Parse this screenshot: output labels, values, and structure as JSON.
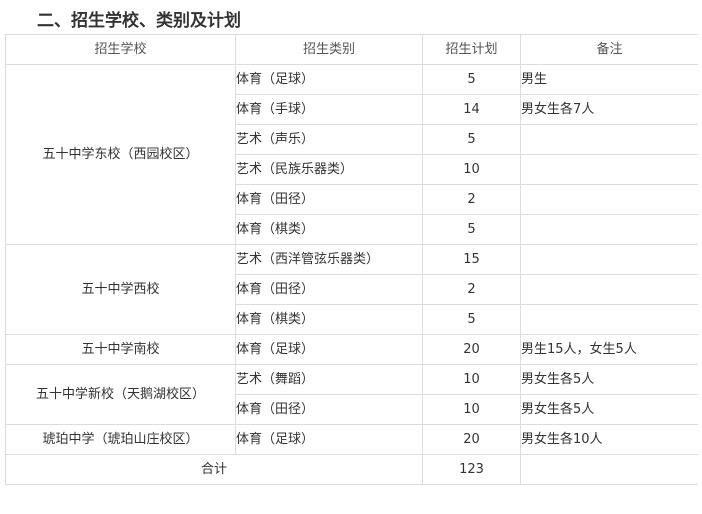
{
  "heading": "二、招生学校、类别及计划",
  "table": {
    "headers": {
      "school": "招生学校",
      "category": "招生类别",
      "plan": "招生计划",
      "note": "备注"
    },
    "schools": [
      "五十中学东校（西园校区）",
      "五十中学西校",
      "五十中学南校",
      "五十中学新校（天鹅湖校区）",
      "琥珀中学（琥珀山庄校区）"
    ],
    "rows": [
      {
        "category": "体育（足球）",
        "plan": "5",
        "note": "男生"
      },
      {
        "category": "体育（手球）",
        "plan": "14",
        "note": "男女生各7人"
      },
      {
        "category": "艺术（声乐）",
        "plan": "5",
        "note": ""
      },
      {
        "category": "艺术（民族乐器类）",
        "plan": "10",
        "note": ""
      },
      {
        "category": "体育（田径）",
        "plan": "2",
        "note": ""
      },
      {
        "category": "体育（棋类）",
        "plan": "5",
        "note": ""
      },
      {
        "category": "艺术（西洋管弦乐器类）",
        "plan": "15",
        "note": ""
      },
      {
        "category": "体育（田径）",
        "plan": "2",
        "note": ""
      },
      {
        "category": "体育（棋类）",
        "plan": "5",
        "note": ""
      },
      {
        "category": "体育（足球）",
        "plan": "20",
        "note": "男生15人，女生5人"
      },
      {
        "category": "艺术（舞蹈）",
        "plan": "10",
        "note": "男女生各5人"
      },
      {
        "category": "体育（田径）",
        "plan": "10",
        "note": "男女生各5人"
      },
      {
        "category": "体育（足球）",
        "plan": "20",
        "note": "男女生各10人"
      }
    ],
    "total": {
      "label": "合计",
      "plan": "123",
      "note": ""
    }
  }
}
